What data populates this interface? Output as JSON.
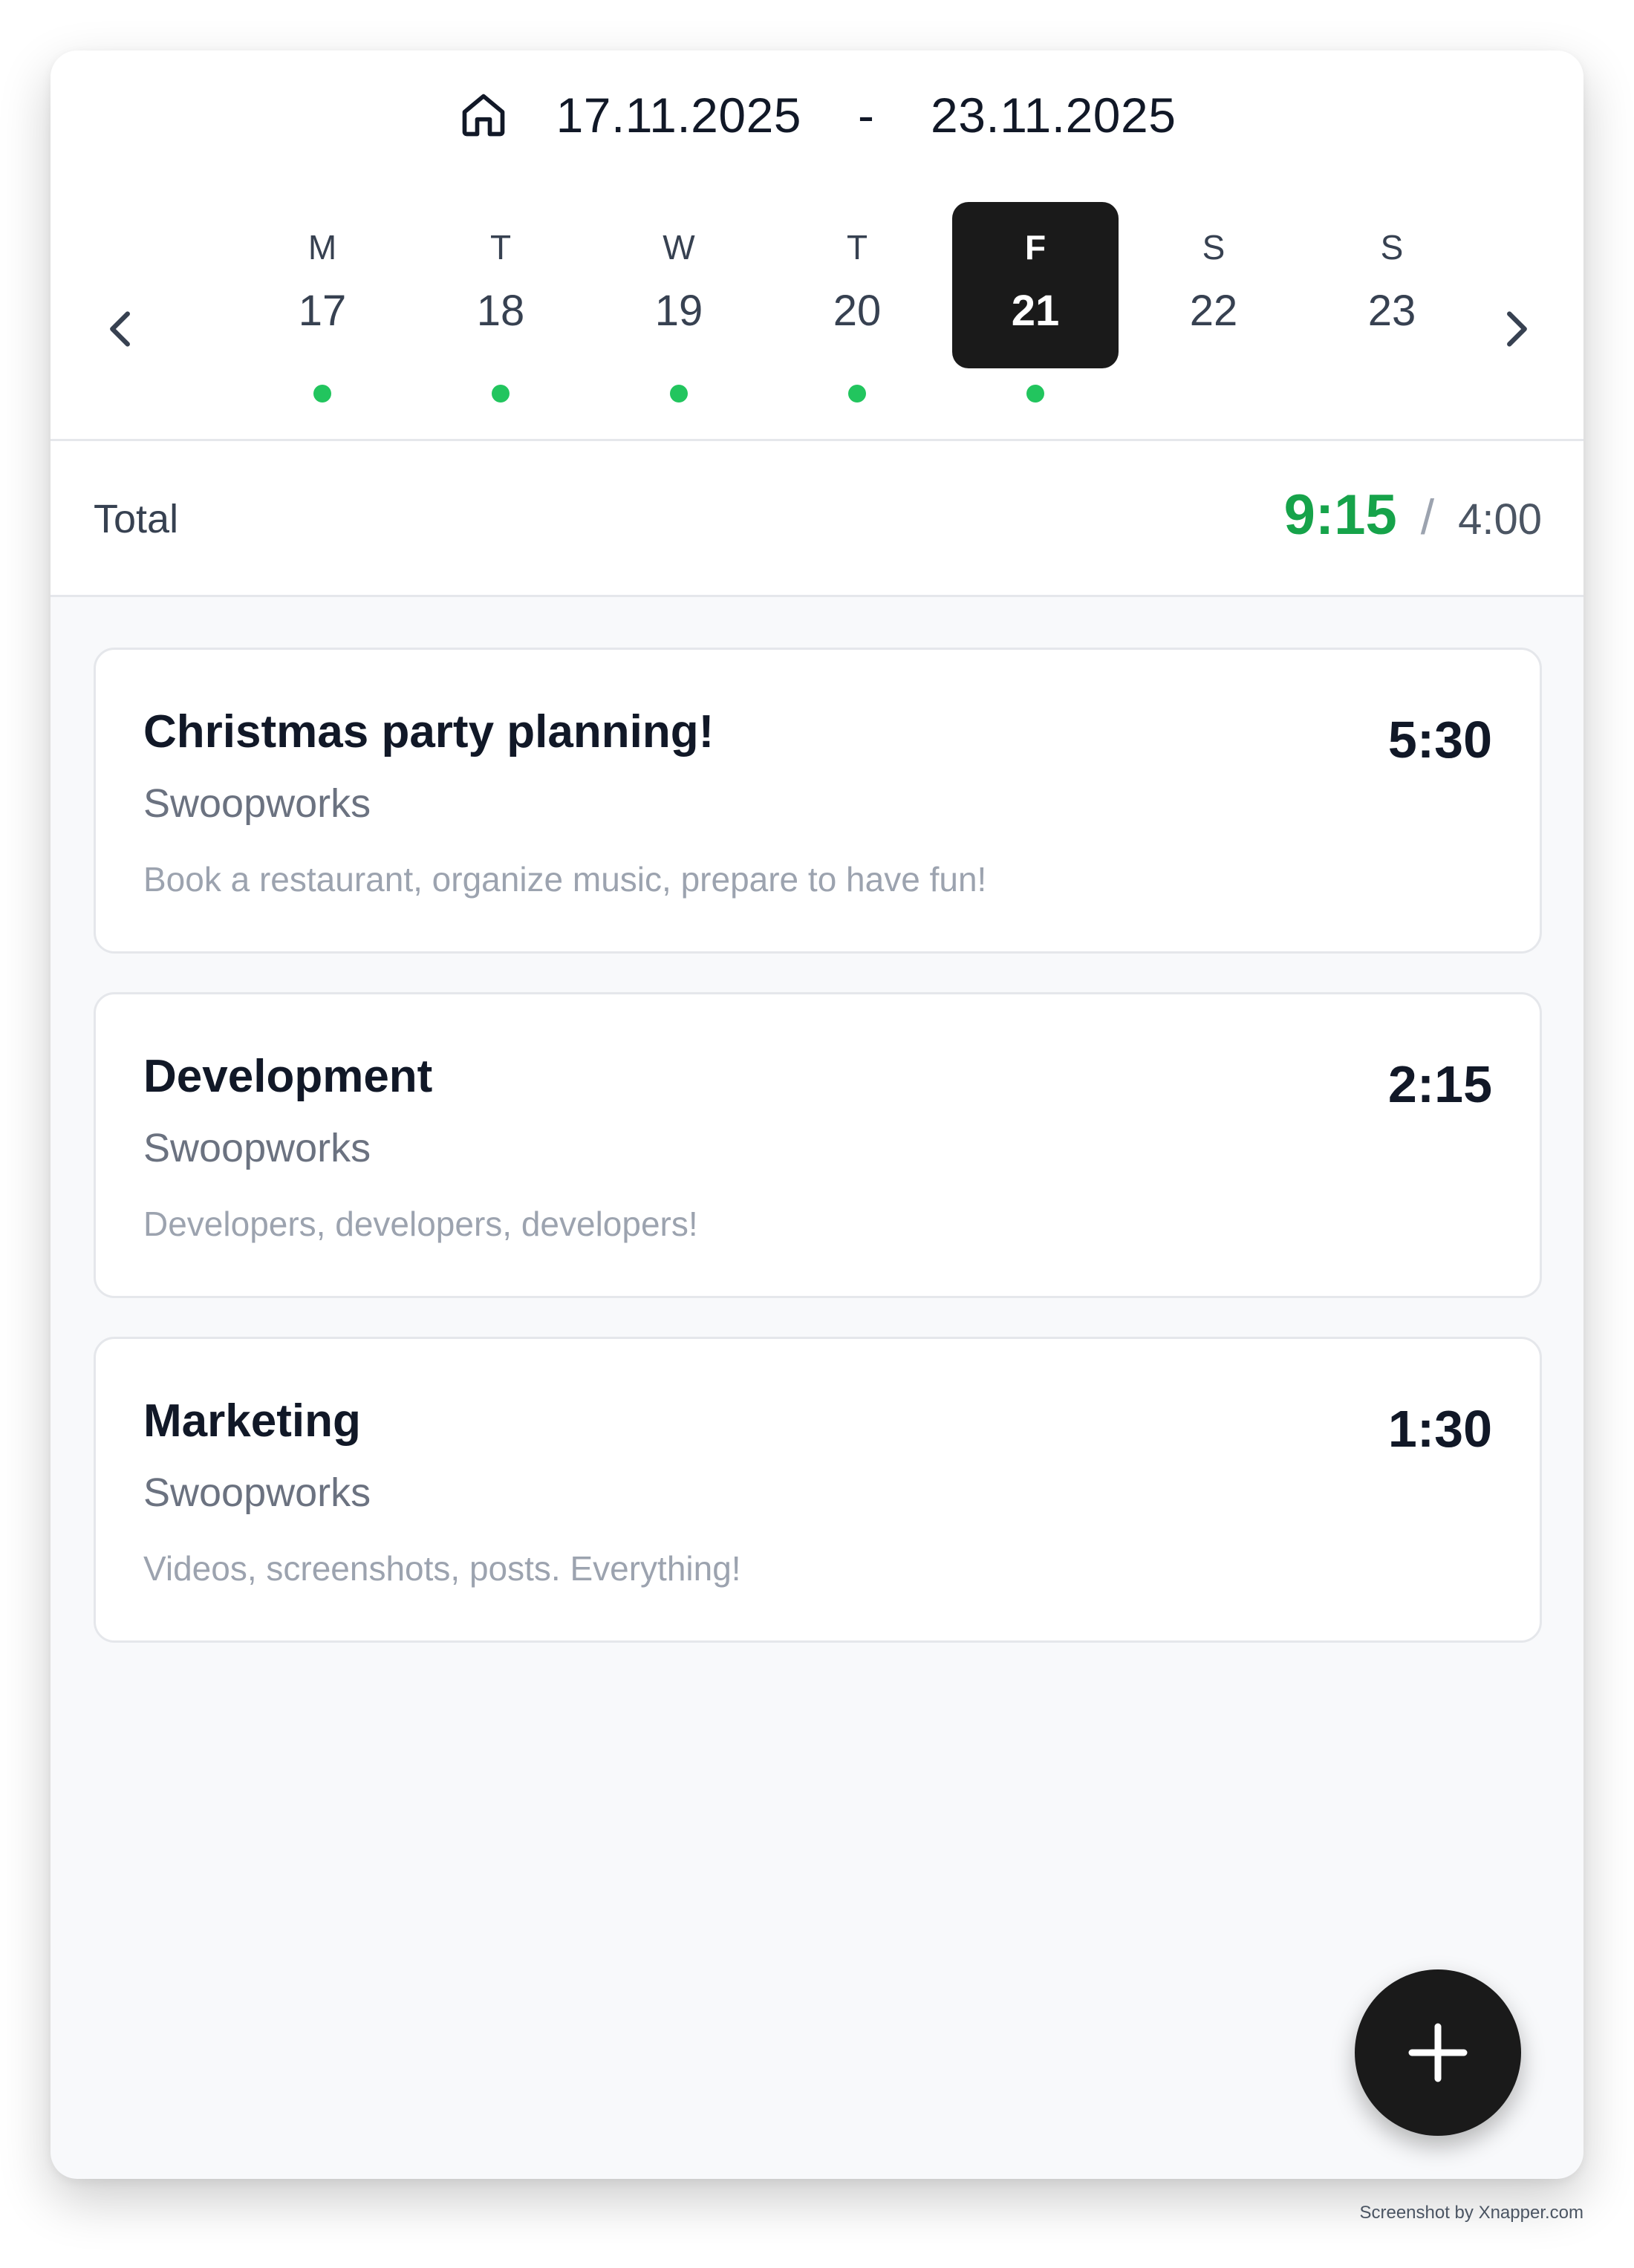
{
  "header": {
    "home_icon": "home-icon",
    "range_start": "17.11.2025",
    "range_separator": "-",
    "range_end": "23.11.2025",
    "prev_icon": "chevron-left-icon",
    "next_icon": "chevron-right-icon"
  },
  "week": {
    "days": [
      {
        "dow": "M",
        "num": "17",
        "has_entries": true,
        "selected": false
      },
      {
        "dow": "T",
        "num": "18",
        "has_entries": true,
        "selected": false
      },
      {
        "dow": "W",
        "num": "19",
        "has_entries": true,
        "selected": false
      },
      {
        "dow": "T",
        "num": "20",
        "has_entries": true,
        "selected": false
      },
      {
        "dow": "F",
        "num": "21",
        "has_entries": true,
        "selected": true
      },
      {
        "dow": "S",
        "num": "22",
        "has_entries": false,
        "selected": false
      },
      {
        "dow": "S",
        "num": "23",
        "has_entries": false,
        "selected": false
      }
    ]
  },
  "total": {
    "label": "Total",
    "logged": "9:15",
    "separator": "/",
    "target": "4:00"
  },
  "entries": [
    {
      "title": "Christmas party planning!",
      "client": "Swoopworks",
      "description": "Book a restaurant, organize music, prepare to have fun!",
      "duration": "5:30"
    },
    {
      "title": "Development",
      "client": "Swoopworks",
      "description": "Developers, developers, developers!",
      "duration": "2:15"
    },
    {
      "title": "Marketing",
      "client": "Swoopworks",
      "description": "Videos, screenshots, posts. Everything!",
      "duration": "1:30"
    }
  ],
  "fab": {
    "icon": "plus-icon"
  },
  "watermark": "Screenshot by Xnapper.com",
  "colors": {
    "accent_green": "#16a34a",
    "dot_green": "#22c55e",
    "selected_bg": "#1a1a1a",
    "card_bg": "#f8f9fb"
  }
}
